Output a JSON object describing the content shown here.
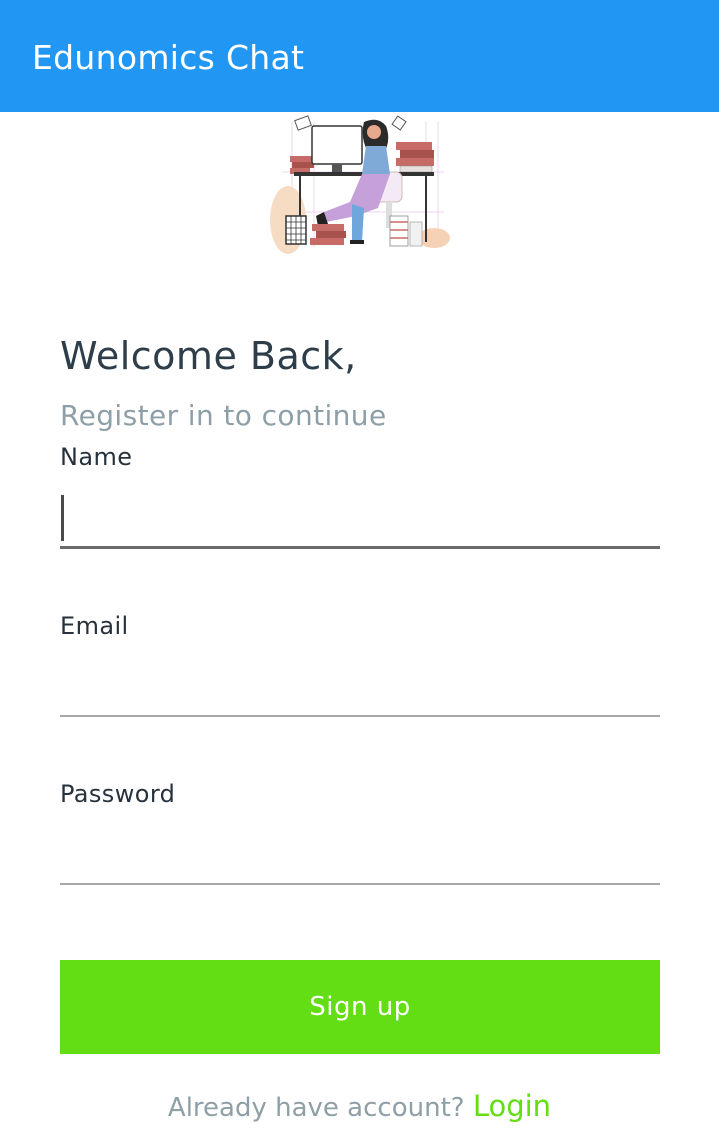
{
  "app_bar": {
    "title": "Edunomics Chat",
    "color": "#2196f3"
  },
  "illustration": {
    "icon": "woman-at-desk-illustration"
  },
  "heading": {
    "title": "Welcome Back,",
    "subtitle": "Register in to continue"
  },
  "form": {
    "name": {
      "label": "Name",
      "value": ""
    },
    "email": {
      "label": "Email",
      "value": ""
    },
    "password": {
      "label": "Password",
      "value": ""
    }
  },
  "signup_button": {
    "label": "Sign up",
    "color": "#63dd14"
  },
  "footer": {
    "question": "Already have account?",
    "login_label": "Login",
    "login_color": "#63dd14"
  }
}
